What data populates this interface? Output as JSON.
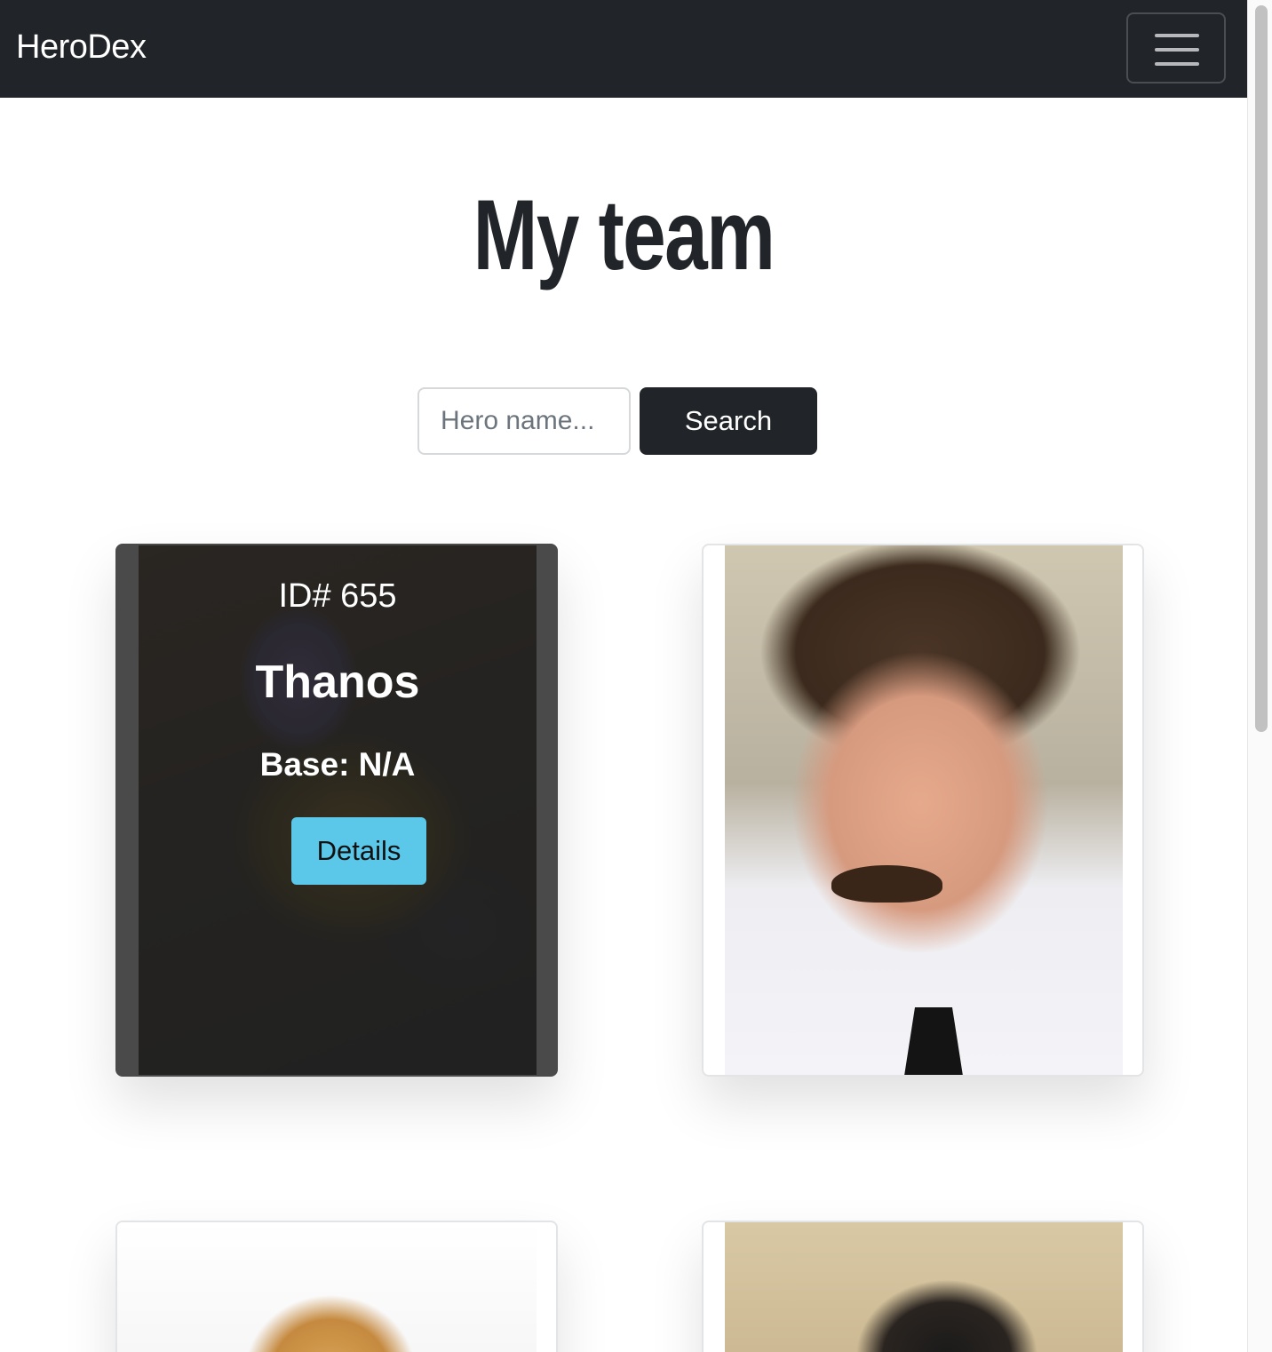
{
  "navbar": {
    "brand": "HeroDex"
  },
  "main": {
    "title": "My team",
    "search": {
      "placeholder": "Hero name...",
      "value": "",
      "button_label": "Search"
    },
    "cards": [
      {
        "id_label": "ID# 655",
        "name": "Thanos",
        "base": "Base: N/A",
        "details_label": "Details",
        "state": "hover-overlay"
      },
      {
        "state": "image"
      },
      {
        "state": "image"
      },
      {
        "state": "image"
      }
    ]
  },
  "colors": {
    "navbar_bg": "#212529",
    "search_button_bg": "#212529",
    "details_button_bg": "#5bc8ea"
  },
  "icons": {
    "menu_toggle": "hamburger-icon"
  }
}
